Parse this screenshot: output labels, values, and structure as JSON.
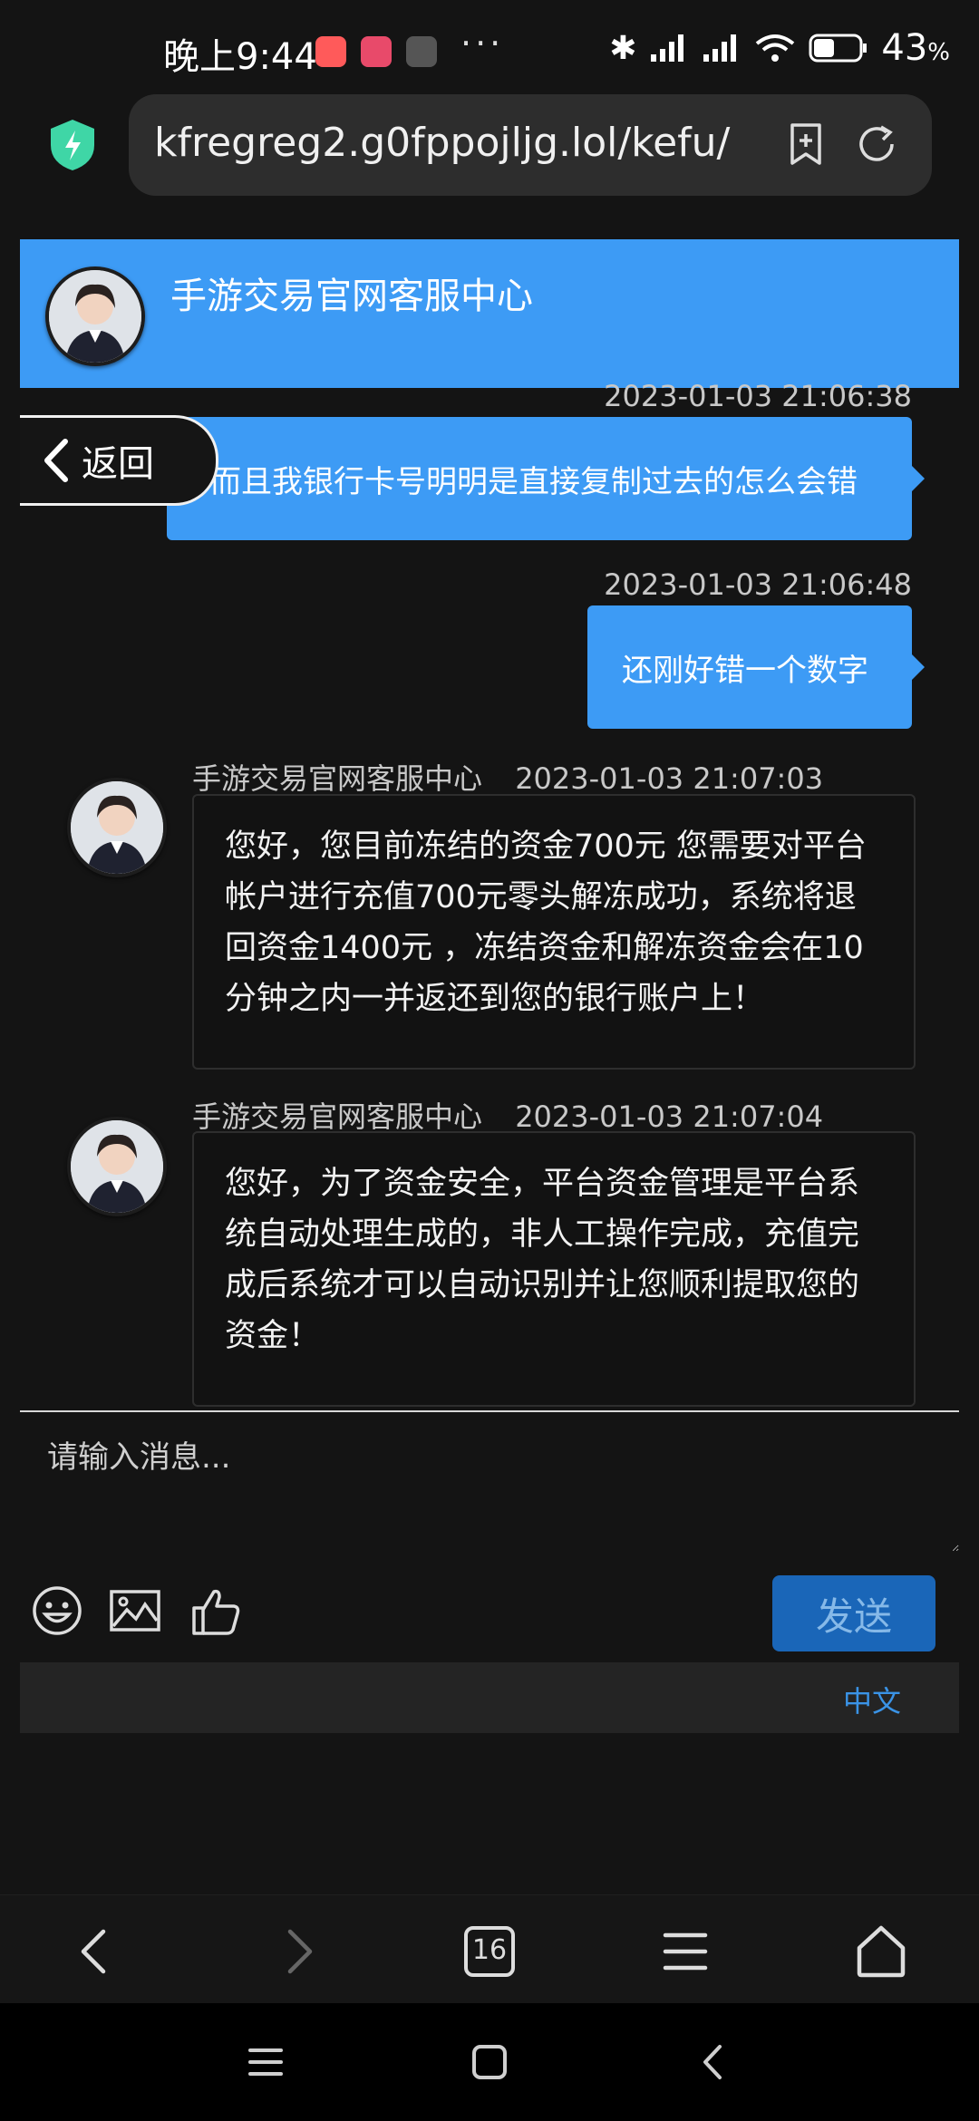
{
  "status_bar": {
    "time": "晚上9:44",
    "more": "···",
    "battery_pct": "43",
    "battery_unit": "%"
  },
  "browser": {
    "url": "kfregreg2.g0fppojljg.lol/kefu/",
    "tab_count": "16"
  },
  "chat": {
    "header_title": "手游交易官网客服中心",
    "back_label": "返回",
    "messages": [
      {
        "direction": "out",
        "time": "2023-01-03 21:06:38",
        "text": "而且我银行卡号明明是直接复制过去的怎么会错"
      },
      {
        "direction": "out",
        "time": "2023-01-03 21:06:48",
        "text": "还刚好错一个数字"
      },
      {
        "direction": "in",
        "sender": "手游交易官网客服中心",
        "time": "2023-01-03 21:07:03",
        "text": "您好，您目前冻结的资金700元 您需要对平台帐户进行充值700元零头解冻成功，系统将退回资金1400元 ，冻结资金和解冻资金会在10分钟之内一并返还到您的银行账户上！"
      },
      {
        "direction": "in",
        "sender": "手游交易官网客服中心",
        "time": "2023-01-03 21:07:04",
        "text": "您好，为了资金安全，平台资金管理是平台系统自动处理生成的，非人工操作完成，充值完成后系统才可以自动识别并让您顺利提取您的资金！"
      }
    ]
  },
  "composer": {
    "placeholder": "请输入消息...",
    "send_label": "发送",
    "language_label": "中文"
  },
  "colors": {
    "accent": "#3d9bf5",
    "send": "#1a66b8",
    "background": "#141414"
  },
  "icons": [
    "shield-icon",
    "bookmark-add-icon",
    "reload-icon",
    "emoji-icon",
    "image-icon",
    "thumbs-up-icon",
    "back-arrow-icon",
    "forward-arrow-icon",
    "tabs-icon",
    "menu-icon",
    "home-icon"
  ]
}
